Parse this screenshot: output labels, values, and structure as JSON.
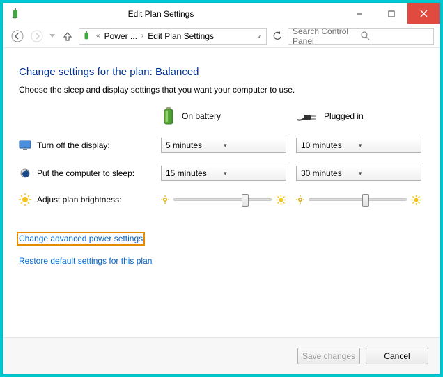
{
  "window": {
    "title": "Edit Plan Settings"
  },
  "nav": {
    "crumb1": "Power ...",
    "crumb2": "Edit Plan Settings",
    "search_placeholder": "Search Control Panel"
  },
  "page": {
    "heading": "Change settings for the plan: Balanced",
    "subheading": "Choose the sleep and display settings that you want your computer to use.",
    "col_battery": "On battery",
    "col_plugged": "Plugged in",
    "row_display": "Turn off the display:",
    "row_sleep": "Put the computer to sleep:",
    "row_brightness": "Adjust plan brightness:",
    "display_battery_value": "5 minutes",
    "display_plugged_value": "10 minutes",
    "sleep_battery_value": "15 minutes",
    "sleep_plugged_value": "30 minutes",
    "brightness_battery_pct": 70,
    "brightness_plugged_pct": 55,
    "link_advanced": "Change advanced power settings",
    "link_restore": "Restore default settings for this plan"
  },
  "footer": {
    "save": "Save changes",
    "cancel": "Cancel"
  }
}
